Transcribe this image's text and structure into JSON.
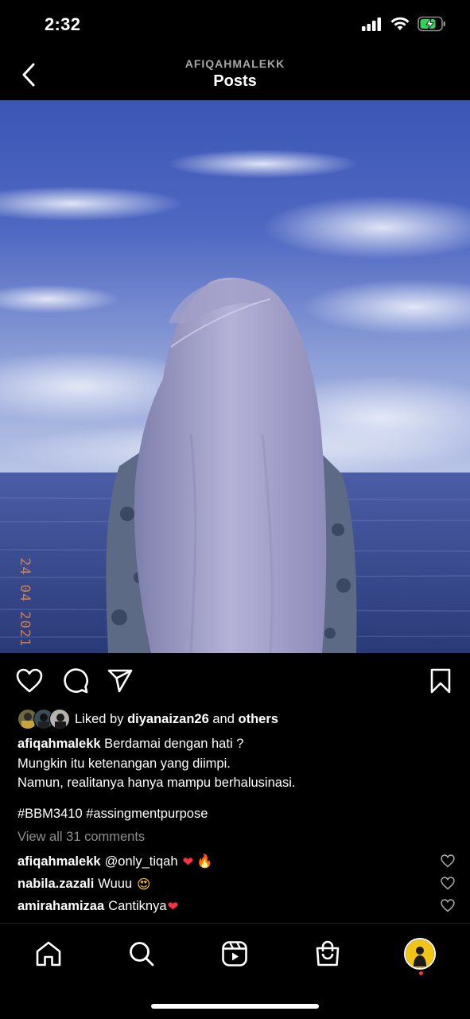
{
  "status_bar": {
    "time": "2:32",
    "icons": [
      "cellular-signal-icon",
      "wifi-icon",
      "battery-charging-icon"
    ],
    "battery_color": "#30d158"
  },
  "header": {
    "username": "AFIQAHMALEKK",
    "title": "Posts",
    "back_icon": "chevron-left-icon"
  },
  "post": {
    "image_description_icon": "photo-sea-sky",
    "date_stamp": "24 04 2021",
    "actions": {
      "like_icon": "heart-outline-icon",
      "comment_icon": "comment-bubble-icon",
      "share_icon": "paper-plane-icon",
      "save_icon": "bookmark-outline-icon"
    },
    "likes": {
      "prefix": "Liked by",
      "user": "diyanaizan26",
      "joiner": "and",
      "suffix": "others"
    },
    "caption": {
      "author": "afiqahmalekk",
      "line1": "Berdamai dengan hati ?",
      "line2": "Mungkin itu ketenangan yang diimpi.",
      "line3": "Namun, realitanya hanya mampu berhalusinasi.",
      "hashtags": "#BBM3410 #assingmentpurpose"
    },
    "view_all_comments": "View all 31 comments",
    "comments": [
      {
        "user": "afiqahmalekk",
        "text": "@only_tiqah",
        "emoji": [
          "❤",
          "🔥"
        ]
      },
      {
        "user": "nabila.zazali",
        "text": "Wuuu",
        "emoji": [
          "😍"
        ]
      },
      {
        "user": "amirahamizaa",
        "text": "Cantiknya",
        "emoji": [
          "❤"
        ]
      }
    ]
  },
  "tab_bar": {
    "tabs": [
      "home-icon",
      "search-icon",
      "reels-icon",
      "shop-icon",
      "profile-avatar"
    ],
    "notification_dot_color": "#ff3040"
  }
}
